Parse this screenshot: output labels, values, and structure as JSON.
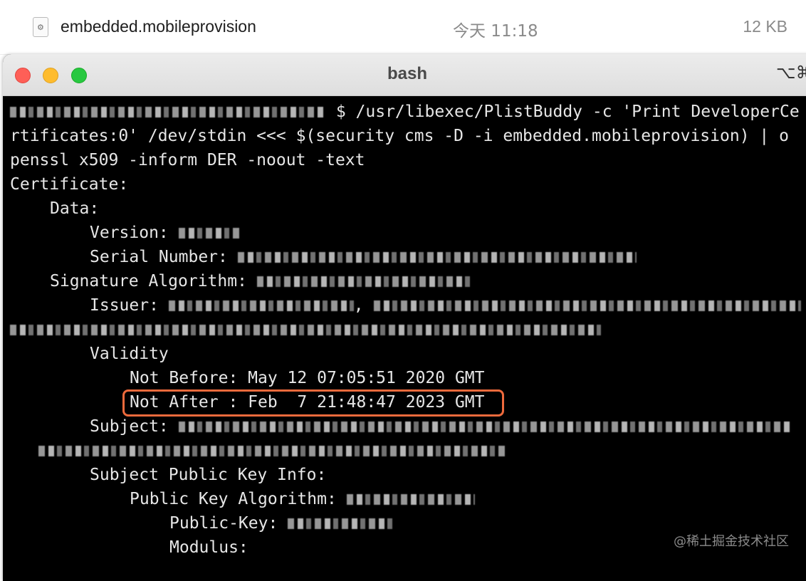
{
  "finder_row": {
    "file_name": "embedded.mobileprovision",
    "date": "今天 11:18",
    "size": "12 KB",
    "icon": "gear-icon"
  },
  "window": {
    "title": "bash",
    "shortcut": "⌥⌘"
  },
  "terminal": {
    "command_line_1": "$ /usr/libexec/PlistBuddy -c 'Print DeveloperCe",
    "command_line_2": "rtificates:0' /dev/stdin <<< $(security cms -D -i embedded.mobileprovision) | o",
    "command_line_3": "penssl x509 -inform DER -noout -text",
    "certificate": "Certificate:",
    "data": "Data:",
    "version": "Version:",
    "serial_number": "Serial Number:",
    "signature_algorithm": "Signature Algorithm:",
    "issuer": "Issuer:",
    "issuer_fragment": ", ",
    "validity": "Validity",
    "not_before": "Not Before: May 12 07:05:51 2020 GMT",
    "not_after": "Not After : Feb  7 21:48:47 2023 GMT",
    "subject": "Subject:",
    "subject_public_key_info": "Subject Public Key Info:",
    "public_key_algorithm": "Public Key Algorithm:",
    "public_key": "Public-Key:",
    "modulus": "Modulus:"
  },
  "watermark": "@稀土掘金技术社区",
  "colors": {
    "highlight": "#ee6a3c",
    "terminal_bg": "#000000",
    "terminal_fg": "#e6e6e6"
  }
}
